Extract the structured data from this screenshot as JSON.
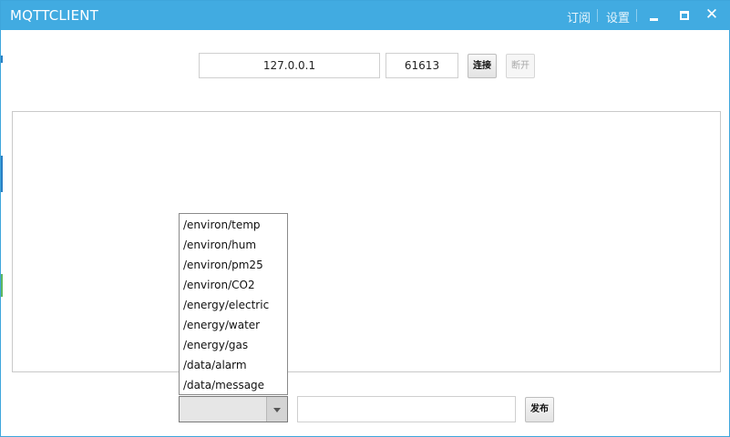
{
  "window": {
    "title": "MQTTCLIENT",
    "menu": {
      "subscribe": "订阅",
      "settings": "设置"
    },
    "controls": {
      "close_glyph": "✕"
    }
  },
  "connection": {
    "host": "127.0.0.1",
    "port": "61613",
    "connect_label": "连接",
    "disconnect_label": "断开",
    "disconnect_enabled": false
  },
  "messages": {
    "content": ""
  },
  "publish": {
    "topics": [
      "/environ/temp",
      "/environ/hum",
      "/environ/pm25",
      "/environ/CO2",
      "/energy/electric",
      "/energy/water",
      "/energy/gas",
      "/data/alarm",
      "/data/message"
    ],
    "selected_topic": "",
    "payload": "",
    "publish_label": "发布"
  },
  "colors": {
    "titlebar": "#41abe1",
    "border": "#3ea6dc"
  }
}
